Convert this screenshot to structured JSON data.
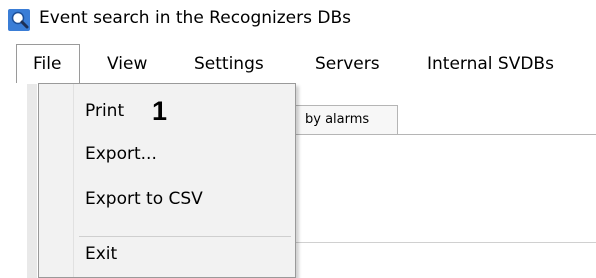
{
  "window": {
    "title": "Event search in the Recognizers DBs",
    "title_icon": "search-icon"
  },
  "menubar": {
    "items": [
      {
        "label": "File",
        "open": true
      },
      {
        "label": "View"
      },
      {
        "label": "Settings"
      },
      {
        "label": "Servers"
      },
      {
        "label": "Internal SVDBs"
      }
    ]
  },
  "background": {
    "tab_label": "by alarms"
  },
  "file_menu": {
    "items": [
      {
        "label": "Print"
      },
      {
        "label": "Export..."
      },
      {
        "label": "Export to CSV"
      },
      {
        "label": "Exit"
      }
    ],
    "callout": "1"
  },
  "colors": {
    "menu_background": "#f2f2f2",
    "border": "#9a9a9a",
    "icon_blue": "#2a6fc9"
  }
}
